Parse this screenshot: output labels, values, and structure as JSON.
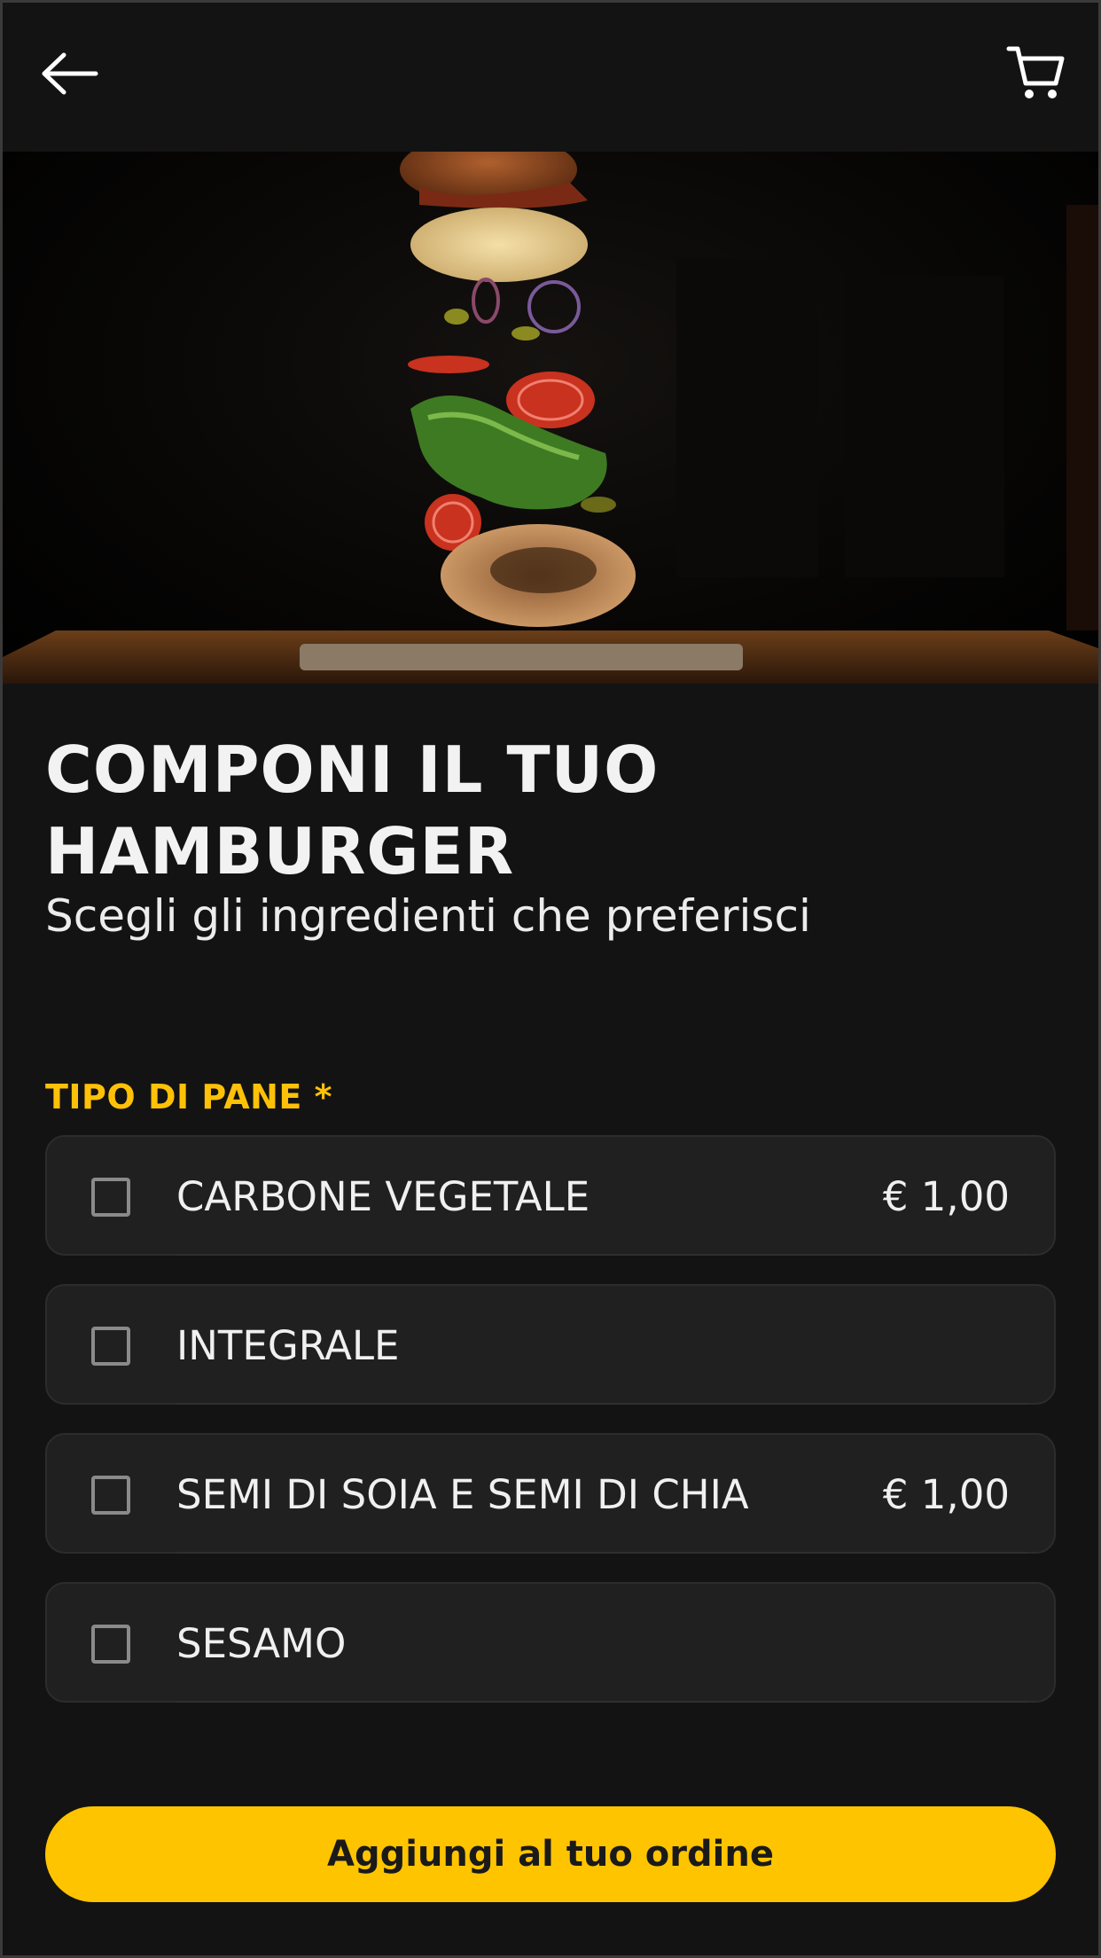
{
  "header": {
    "back_icon": "arrow-left-icon",
    "cart_icon": "shopping-cart-icon"
  },
  "hero": {
    "image": "floating-burger-ingredients-photo"
  },
  "main": {
    "title": "COMPONI IL TUO HAMBURGER",
    "subtitle": "Scegli gli ingredienti che preferisci",
    "section_label": "TIPO DI PANE *",
    "options": [
      {
        "label": "CARBONE VEGETALE",
        "price": "€ 1,00",
        "checked": false
      },
      {
        "label": "INTEGRALE",
        "price": "",
        "checked": false
      },
      {
        "label": "SEMI DI SOIA E SEMI DI CHIA",
        "price": "€ 1,00",
        "checked": false
      },
      {
        "label": "SESAMO",
        "price": "",
        "checked": false
      }
    ],
    "add_button_label": "Aggiungi al tuo ordine"
  },
  "colors": {
    "background": "#131313",
    "accent": "#ffc400",
    "card": "#202020"
  }
}
